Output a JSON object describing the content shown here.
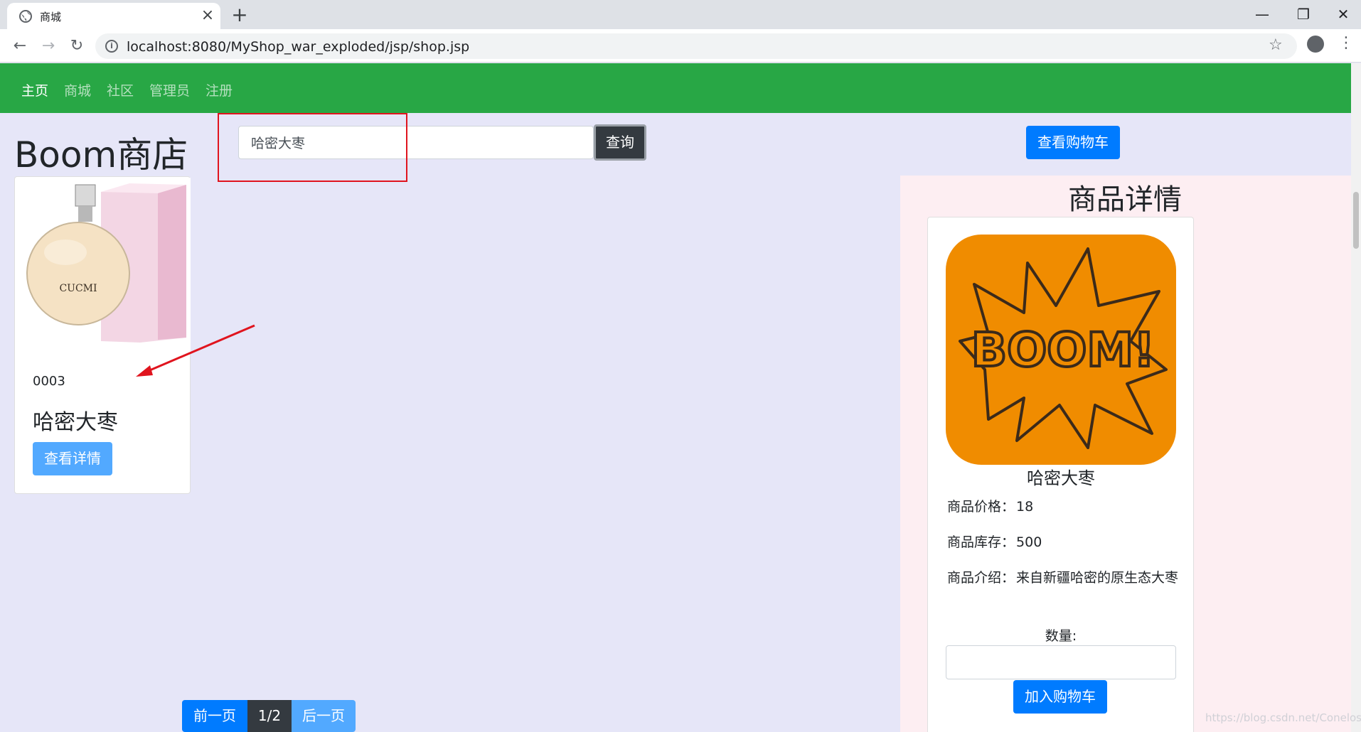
{
  "browser": {
    "tab_title": "商城",
    "tab_close": "×",
    "new_tab": "+",
    "url": "localhost:8080/MyShop_war_exploded/jsp/shop.jsp",
    "minimize": "—",
    "restore": "❐",
    "close": "✕"
  },
  "nav": {
    "items": [
      "主页",
      "商城",
      "社区",
      "管理员",
      "注册"
    ]
  },
  "store": {
    "title": "Boom商店"
  },
  "search": {
    "value": "哈密大枣",
    "button": "查询"
  },
  "cart": {
    "view_button": "查看购物车"
  },
  "product": {
    "id": "0003",
    "name": "哈密大枣",
    "detail_button": "查看详情",
    "image_brand": "CUCMI"
  },
  "pager": {
    "prev": "前一页",
    "current": "1/2",
    "next": "后一页"
  },
  "detail": {
    "title": "商品详情",
    "image_text": "BOOM!",
    "name": "哈密大枣",
    "price_label": "商品价格：",
    "price": "18",
    "stock_label": "商品库存：",
    "stock": "500",
    "intro_label": "商品介绍：",
    "intro": "来自新疆哈密的原生态大枣",
    "qty_label": "数量:",
    "add_button": "加入购物车"
  },
  "watermark": "https://blog.csdn.net/Conelos",
  "colors": {
    "nav_bg": "#28a745",
    "page_bg": "#e6e6f8",
    "detail_bg": "#fdeef2",
    "primary": "#007bff",
    "dark": "#343a40",
    "highlight": "#e0141e"
  }
}
